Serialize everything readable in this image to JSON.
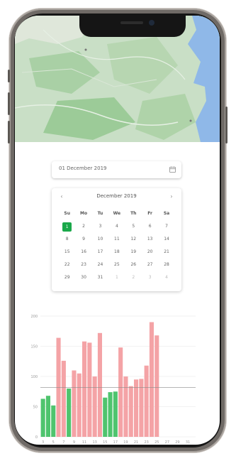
{
  "date_picker": {
    "value": "01 December 2019"
  },
  "calendar": {
    "month_label": "December 2019",
    "prev_icon": "chevron-left-icon",
    "next_icon": "chevron-right-icon",
    "weekdays": [
      "Su",
      "Mo",
      "Tu",
      "We",
      "Th",
      "Fr",
      "Sa"
    ],
    "weeks": [
      [
        {
          "d": "1",
          "sel": true
        },
        {
          "d": "2"
        },
        {
          "d": "3"
        },
        {
          "d": "4"
        },
        {
          "d": "5"
        },
        {
          "d": "6"
        },
        {
          "d": "7"
        }
      ],
      [
        {
          "d": "8"
        },
        {
          "d": "9"
        },
        {
          "d": "10"
        },
        {
          "d": "11"
        },
        {
          "d": "12"
        },
        {
          "d": "13"
        },
        {
          "d": "14"
        }
      ],
      [
        {
          "d": "15"
        },
        {
          "d": "16"
        },
        {
          "d": "17"
        },
        {
          "d": "18"
        },
        {
          "d": "19"
        },
        {
          "d": "20"
        },
        {
          "d": "21"
        }
      ],
      [
        {
          "d": "22"
        },
        {
          "d": "23"
        },
        {
          "d": "24"
        },
        {
          "d": "25"
        },
        {
          "d": "26"
        },
        {
          "d": "27"
        },
        {
          "d": "28"
        }
      ],
      [
        {
          "d": "29"
        },
        {
          "d": "30"
        },
        {
          "d": "31"
        },
        {
          "d": "1",
          "muted": true
        },
        {
          "d": "2",
          "muted": true
        },
        {
          "d": "3",
          "muted": true
        },
        {
          "d": "4",
          "muted": true
        }
      ]
    ],
    "selected_color": "#1aa84a"
  },
  "chart_data": {
    "type": "bar",
    "ylim": [
      0,
      200
    ],
    "y_ticks": [
      "200",
      "150",
      "100",
      "50",
      "0"
    ],
    "threshold": 82,
    "colors": {
      "below": "#4fc46e",
      "above": "#f4a3a6"
    },
    "categories": [
      "3",
      "",
      "5",
      "",
      "7",
      "",
      "9",
      "",
      "11",
      "",
      "13",
      "",
      "15",
      "",
      "17",
      "",
      "19",
      "",
      "21",
      "",
      "23",
      "",
      "25",
      "",
      "27",
      "",
      "29",
      "",
      "31",
      ""
    ],
    "values": [
      63,
      68,
      52,
      164,
      126,
      80,
      110,
      105,
      158,
      156,
      100,
      172,
      65,
      74,
      75,
      148,
      100,
      84,
      95,
      96,
      118,
      190,
      168,
      0,
      0,
      0,
      0,
      0,
      0,
      0
    ]
  }
}
